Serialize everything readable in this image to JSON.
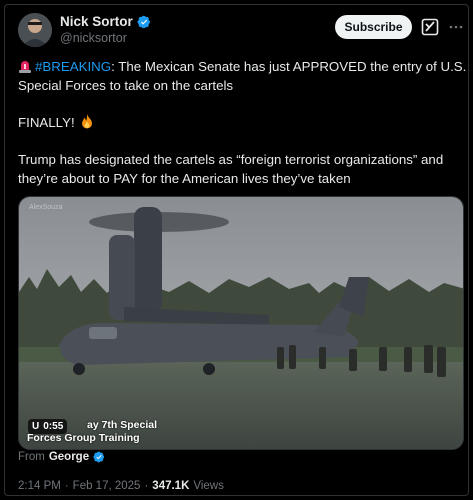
{
  "author": {
    "display_name": "Nick Sortor",
    "handle": "@nicksortor"
  },
  "actions": {
    "subscribe_label": "Subscribe",
    "grok_icon": "grok-icon",
    "more_icon": "more-icon"
  },
  "tweet": {
    "siren_emoji": "siren-emoji",
    "hashtag": "#BREAKING",
    "line1_rest": ": The Mexican Senate has just APPROVED the entry of U.S. Special Forces to take on the cartels",
    "finally": "FINALLY!",
    "fire_emoji": "fire-emoji",
    "para3": "Trump has designated the cartels as “foreign terrorist organizations” and they’re about to PAY for the American lives they’ve taken"
  },
  "media": {
    "watermark": "AlexSouza",
    "timer": "0:55",
    "caption_line1": "U",
    "caption_line1b": "ay 7th Special",
    "caption_line2": "Forces Group Training"
  },
  "from": {
    "label": "From",
    "name": "George"
  },
  "meta": {
    "time": "2:14 PM",
    "separator": "·",
    "date": "Feb 17, 2025",
    "views_count": "347.1K",
    "views_label": "Views"
  },
  "colors": {
    "accent": "#1d9bf0",
    "verified": "#1d9bf0",
    "background": "#000000"
  }
}
